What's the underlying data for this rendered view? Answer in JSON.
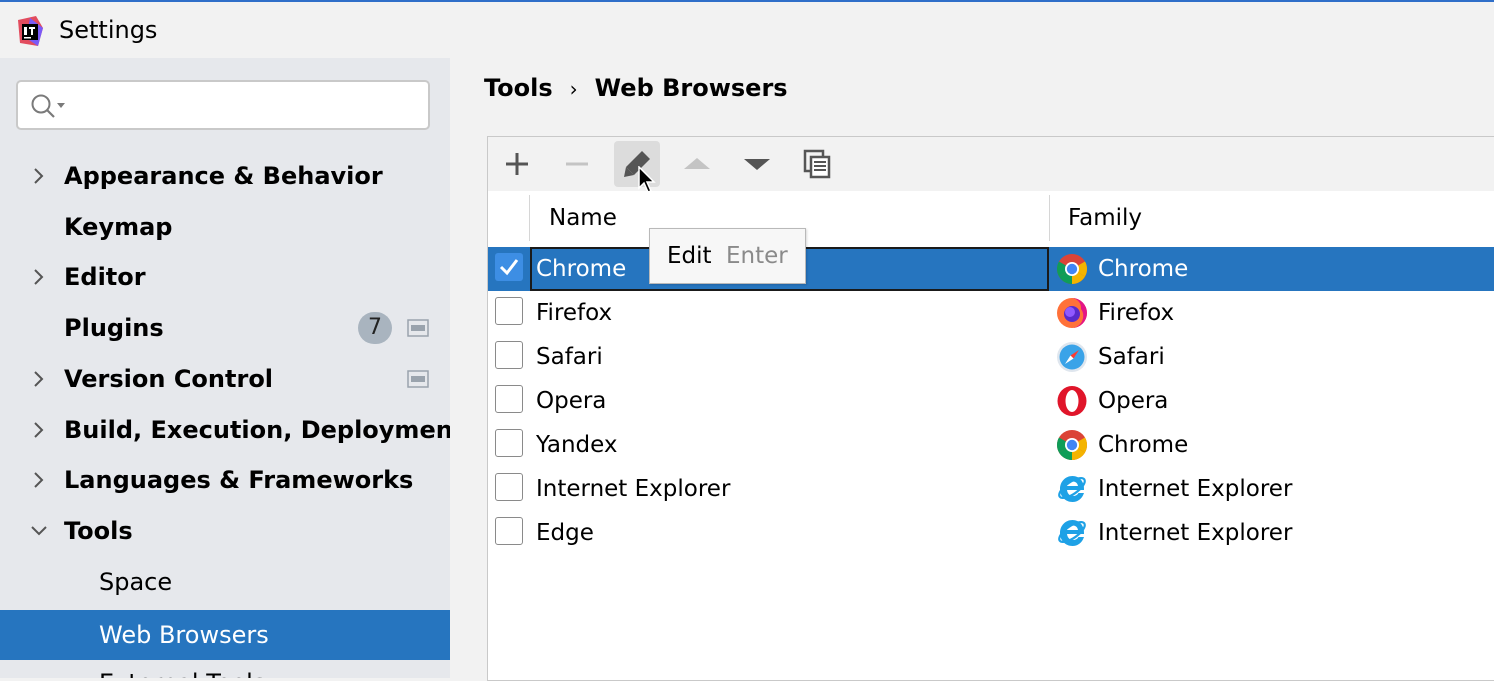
{
  "window": {
    "title": "Settings"
  },
  "sidebar": {
    "search": {
      "value": "",
      "placeholder": ""
    },
    "items": [
      {
        "label": "Appearance & Behavior",
        "expandable": true,
        "expanded": false
      },
      {
        "label": "Keymap",
        "expandable": false
      },
      {
        "label": "Editor",
        "expandable": true,
        "expanded": false
      },
      {
        "label": "Plugins",
        "expandable": false,
        "badge": "7"
      },
      {
        "label": "Version Control",
        "expandable": true,
        "expanded": false
      },
      {
        "label": "Build, Execution, Deployment",
        "expandable": true,
        "expanded": false
      },
      {
        "label": "Languages & Frameworks",
        "expandable": true,
        "expanded": false
      },
      {
        "label": "Tools",
        "expandable": true,
        "expanded": true
      },
      {
        "label": "Space",
        "child": true
      },
      {
        "label": "Web Browsers",
        "child": true,
        "selected": true
      },
      {
        "label": "External Tools",
        "child": true
      }
    ]
  },
  "breadcrumb": {
    "parent": "Tools",
    "separator": "›",
    "current": "Web Browsers"
  },
  "toolbar": {
    "buttons": [
      {
        "name": "add",
        "icon": "plus-icon",
        "enabled": true
      },
      {
        "name": "remove",
        "icon": "minus-icon",
        "enabled": false
      },
      {
        "name": "edit",
        "icon": "pencil-icon",
        "enabled": true,
        "hovered": true
      },
      {
        "name": "move-up",
        "icon": "triangle-up-icon",
        "enabled": false
      },
      {
        "name": "move-down",
        "icon": "triangle-down-icon",
        "enabled": true
      },
      {
        "name": "copy",
        "icon": "copy-icon",
        "enabled": true
      }
    ]
  },
  "tooltip": {
    "label": "Edit",
    "shortcut": "Enter"
  },
  "table": {
    "columns": [
      "Name",
      "Family"
    ],
    "rows": [
      {
        "checked": true,
        "name": "Chrome",
        "family": "Chrome",
        "family_icon": "chrome-icon",
        "selected": true
      },
      {
        "checked": false,
        "name": "Firefox",
        "family": "Firefox",
        "family_icon": "firefox-icon"
      },
      {
        "checked": false,
        "name": "Safari",
        "family": "Safari",
        "family_icon": "safari-icon"
      },
      {
        "checked": false,
        "name": "Opera",
        "family": "Opera",
        "family_icon": "opera-icon"
      },
      {
        "checked": false,
        "name": "Yandex",
        "family": "Chrome",
        "family_icon": "chrome-icon"
      },
      {
        "checked": false,
        "name": "Internet Explorer",
        "family": "Internet Explorer",
        "family_icon": "ie-icon"
      },
      {
        "checked": false,
        "name": "Edge",
        "family": "Internet Explorer",
        "family_icon": "ie-icon"
      }
    ]
  },
  "colors": {
    "selection": "#2675bf",
    "sidebar_bg": "#e6e8ec",
    "accent": "#2f6fc9"
  }
}
